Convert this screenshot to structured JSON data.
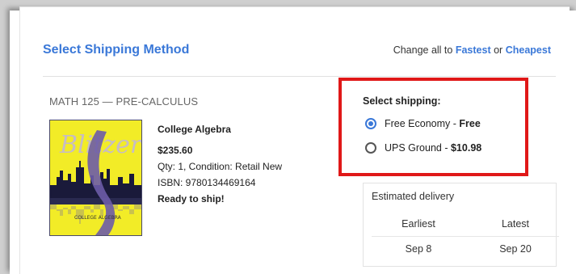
{
  "header": {
    "title": "Select Shipping Method",
    "change_all_prefix": "Change all to",
    "fastest": "Fastest",
    "or": "or",
    "cheapest": "Cheapest"
  },
  "course": "MATH 125 — PRE-CALCULUS",
  "book": {
    "name": "College Algebra",
    "price": "$235.60",
    "qty_condition": "Qty: 1, Condition: Retail New",
    "isbn": "ISBN: 9780134469164",
    "status": "Ready to ship!",
    "cover_author": "Blitzer",
    "cover_title": "COLLEGE ALGEBRA"
  },
  "shipping": {
    "label": "Select shipping:",
    "options": [
      {
        "name": "Free Economy",
        "sep": " - ",
        "price": "Free",
        "selected": true
      },
      {
        "name": "UPS Ground",
        "sep": " - ",
        "price": "$10.98",
        "selected": false
      }
    ]
  },
  "delivery": {
    "header": "Estimated delivery",
    "earliest_label": "Earliest",
    "latest_label": "Latest",
    "earliest": "Sep 8",
    "latest": "Sep 20"
  },
  "colors": {
    "accent": "#3a78d8",
    "highlight_border": "#e01818",
    "cover_yellow": "#f2ec27"
  }
}
